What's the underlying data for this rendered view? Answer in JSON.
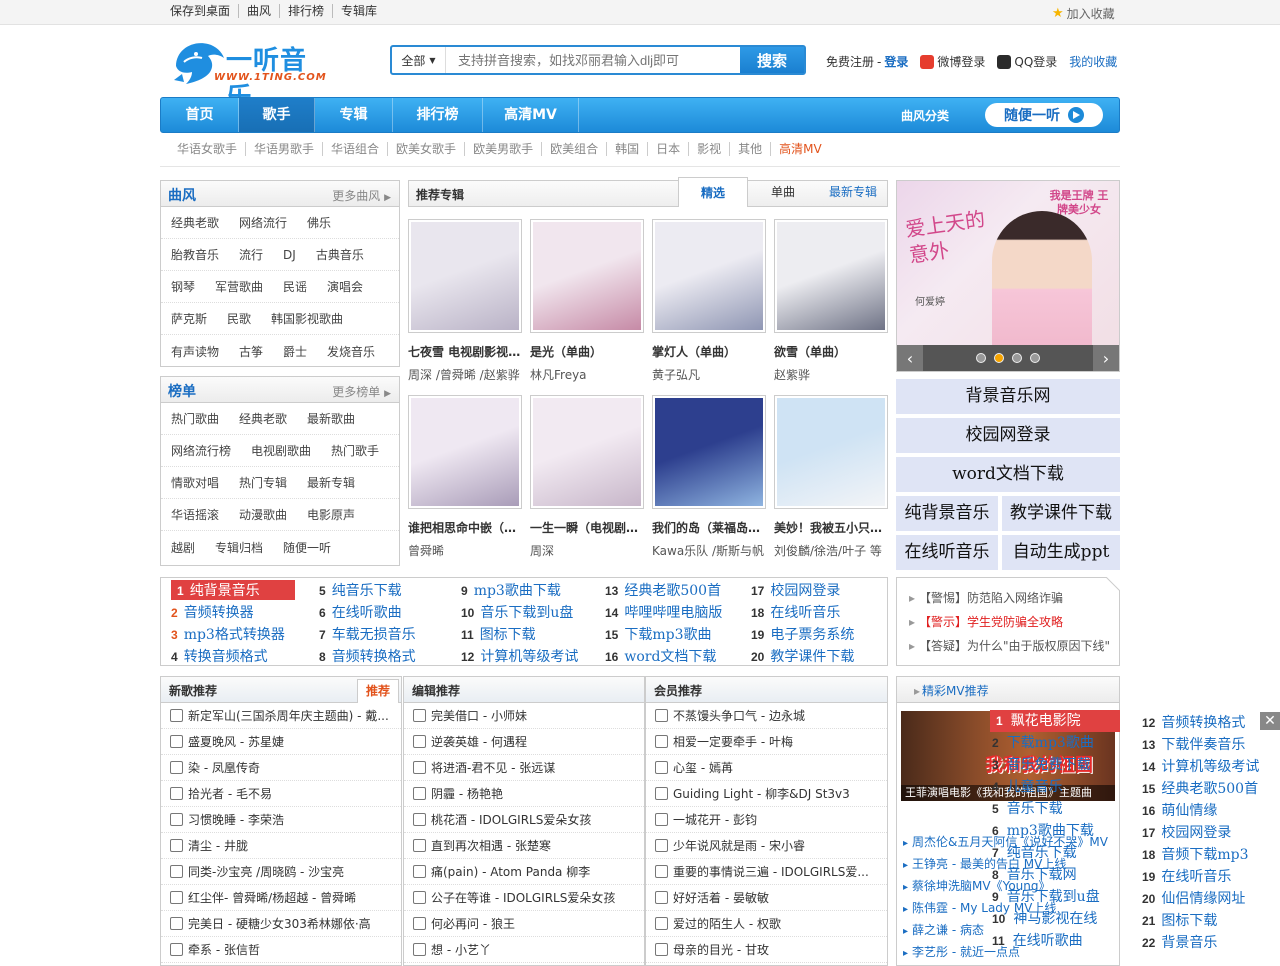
{
  "topbar": {
    "links": [
      "保存到桌面",
      "曲风",
      "排行榜",
      "专辑库"
    ],
    "favorite": "加入收藏"
  },
  "logo": {
    "text": "一听音乐",
    "sub": "WWW.1TING.COM"
  },
  "search": {
    "scope": "全部",
    "placeholder": "支持拼音搜索，如找邓丽君输入dlj即可",
    "button": "搜索"
  },
  "user": {
    "register": "免费注册",
    "sep": "-",
    "login": "登录",
    "weibo": "微博登录",
    "qq": "QQ登录",
    "mine": "我的收藏"
  },
  "nav": {
    "items": [
      "首页",
      "歌手",
      "专辑",
      "排行榜",
      "高清MV"
    ],
    "genre": "曲风分类",
    "random": "随便一听"
  },
  "subnav": [
    "华语女歌手",
    "华语男歌手",
    "华语组合",
    "欧美女歌手",
    "欧美男歌手",
    "欧美组合",
    "韩国",
    "日本",
    "影视",
    "其他",
    "高清MV"
  ],
  "genres": {
    "title": "曲风",
    "more": "更多曲风",
    "rows": [
      [
        "经典老歌",
        "网络流行",
        "佛乐"
      ],
      [
        "胎教音乐",
        "流行",
        "DJ",
        "古典音乐"
      ],
      [
        "钢琴",
        "军营歌曲",
        "民谣",
        "演唱会"
      ],
      [
        "萨克斯",
        "民歌",
        "韩国影视歌曲"
      ],
      [
        "有声读物",
        "古筝",
        "爵士",
        "发烧音乐"
      ]
    ]
  },
  "charts": {
    "title": "榜单",
    "more": "更多榜单",
    "rows": [
      [
        "热门歌曲",
        "经典老歌",
        "最新歌曲"
      ],
      [
        "网络流行榜",
        "电视剧歌曲",
        "热门歌手"
      ],
      [
        "情歌对唱",
        "热门专辑",
        "最新专辑"
      ],
      [
        "华语摇滚",
        "动漫歌曲",
        "电影原声"
      ],
      [
        "越剧",
        "专辑归档",
        "随便一听"
      ]
    ]
  },
  "albums": {
    "title": "推荐专辑",
    "tabs": [
      "精选",
      "单曲",
      "最新专辑"
    ],
    "items": [
      {
        "name": "七夜雪 电视剧影视原声带",
        "artist": "周深 /曾舜晞 /赵紫骅",
        "c1": "#e9e6ee",
        "c2": "#b9b2c6"
      },
      {
        "name": "是光（单曲）",
        "artist": "林凡Freya",
        "c1": "#f1e6ee",
        "c2": "#c68aa6"
      },
      {
        "name": "掌灯人（单曲）",
        "artist": "黄子弘凡",
        "c1": "#ecebf2",
        "c2": "#8f96b3"
      },
      {
        "name": "欲雪（单曲）",
        "artist": "赵紫骅",
        "c1": "#ededf1",
        "c2": "#6f7386"
      },
      {
        "name": "谁把相思命中嵌（单曲）",
        "artist": "曾舜晞",
        "c1": "#efe8f2",
        "c2": "#a99cb8"
      },
      {
        "name": "一生一瞬（电视剧《七夜雪》插曲）",
        "artist": "周深",
        "c1": "#f2eaf2",
        "c2": "#c7b6c9"
      },
      {
        "name": "我们的岛（莱福岛电影主题曲）",
        "artist": "Kawa乐队 /斯斯与帆",
        "c1": "#2d3f8e",
        "c2": "#8fb4e0"
      },
      {
        "name": "美妙！我被五小只包围了",
        "artist": "刘俊麟/徐浩/叶子 等",
        "c1": "#cfe3f4",
        "c2": "#f2f4f7"
      }
    ]
  },
  "banner": {
    "caption1": "爱上天的意外",
    "caption2": "何爱婷",
    "tag": "我是王牌 王牌美少女"
  },
  "right_links": [
    [
      "背景音乐网"
    ],
    [
      "校园网登录"
    ],
    [
      "word文档下载"
    ],
    [
      "纯背景音乐",
      "教学课件下载"
    ],
    [
      "在线听音乐",
      "自动生成ppt"
    ]
  ],
  "rank": [
    {
      "n": "1",
      "t": "纯背景音乐"
    },
    {
      "n": "2",
      "t": "音频转换器"
    },
    {
      "n": "3",
      "t": "mp3格式转换器"
    },
    {
      "n": "4",
      "t": "转换音频格式"
    },
    {
      "n": "5",
      "t": "纯音乐下载"
    },
    {
      "n": "6",
      "t": "在线听歌曲"
    },
    {
      "n": "7",
      "t": "车载无损音乐"
    },
    {
      "n": "8",
      "t": "音频转换格式"
    },
    {
      "n": "9",
      "t": "mp3歌曲下载"
    },
    {
      "n": "10",
      "t": "音乐下载到u盘"
    },
    {
      "n": "11",
      "t": "图标下载"
    },
    {
      "n": "12",
      "t": "计算机等级考试"
    },
    {
      "n": "13",
      "t": "经典老歌500首"
    },
    {
      "n": "14",
      "t": "哔哩哔哩电脑版"
    },
    {
      "n": "15",
      "t": "下载mp3歌曲"
    },
    {
      "n": "16",
      "t": "word文档下载"
    },
    {
      "n": "17",
      "t": "校园网登录"
    },
    {
      "n": "18",
      "t": "在线听音乐"
    },
    {
      "n": "19",
      "t": "电子票务系统"
    },
    {
      "n": "20",
      "t": "教学课件下载"
    }
  ],
  "notices": [
    {
      "t": "【警惕】防范陷入网络诈骗"
    },
    {
      "t": "【警示】学生党防骗全攻略"
    },
    {
      "t": "【答疑】为什么\"由于版权原因下线\""
    }
  ],
  "new_songs": {
    "title": "新歌推荐",
    "tab": "推荐",
    "items": [
      "新定军山(三国杀周年庆主题曲) - 戴...",
      "盛夏晚风 - 苏星婕",
      "染 - 凤凰传奇",
      "拾光者 - 毛不易",
      "习惯晚睡 - 李荣浩",
      "清尘 - 井胧",
      "同类-沙宝亮 /周晓鸥 - 沙宝亮",
      "红尘伴- 曾舜晞/杨超越 - 曾舜晞",
      "完美日 - 硬糖少女303希林娜依·高",
      "牵系 - 张信哲"
    ]
  },
  "editor_songs": {
    "title": "编辑推荐",
    "items": [
      "完美借口 - 小师妹",
      "逆袭英雄 - 何遇程",
      "将进酒-君不见 - 张远谋",
      "阴霾 - 杨艳艳",
      "桃花酒 - IDOLGIRLS爱朵女孩",
      "直到再次相遇 - 张楚寒",
      "痛(pain) - Atom Panda 柳李",
      "公子在等谁 - IDOLGIRLS爱朵女孩",
      "何必再问 - 狼王",
      "想 - 小艺丫"
    ]
  },
  "member_songs": {
    "title": "会员推荐",
    "items": [
      "不蒸馒头争口气 - 边永城",
      "相爱一定要牵手 - 叶梅",
      "心玺 - 嫣苒",
      "Guiding Light - 柳李&DJ St3v3",
      "一城花开 - 彭钧",
      "少年说风就是雨 - 宋小睿",
      "重要的事情说三遍 - IDOLGIRLS爱...",
      "好好活着 - 晏敏敏",
      "爱过的陌生人 - 权歌",
      "母亲的目光 - 甘玫"
    ]
  },
  "mv": {
    "title": "精彩MV推荐",
    "caption": "王菲演唱电影《我和我的祖国》主题曲",
    "image_text": "我和我的祖国",
    "items": [
      "周杰伦&五月天阿信《说好不哭》MV",
      "王铮亮 - 最美的告白 MV上线",
      "蔡徐坤洗脑MV《Young》",
      "陈伟霆 - My Lady MV上线",
      "薛之谦 - 病态",
      "李艺彤 - 就近一点点"
    ]
  },
  "float1": {
    "head": {
      "n": "1",
      "t": "飘花电影院"
    },
    "items": [
      {
        "n": "2",
        "t": "下载mp3歌曲"
      },
      {
        "n": "3",
        "t": "音乐免费下载"
      },
      {
        "n": "4",
        "t": "儿童音乐"
      },
      {
        "n": "5",
        "t": "音乐下载"
      },
      {
        "n": "6",
        "t": "mp3歌曲下载"
      },
      {
        "n": "7",
        "t": "纯音乐下载"
      },
      {
        "n": "8",
        "t": "音乐下载网"
      },
      {
        "n": "9",
        "t": "音乐下载到u盘"
      },
      {
        "n": "10",
        "t": "神马影视在线"
      },
      {
        "n": "11",
        "t": "在线听歌曲"
      }
    ]
  },
  "float2": {
    "close": "✕",
    "items": [
      {
        "n": "12",
        "t": "音频转换格式"
      },
      {
        "n": "13",
        "t": "下载伴奏音乐"
      },
      {
        "n": "14",
        "t": "计算机等级考试"
      },
      {
        "n": "15",
        "t": "经典老歌500首"
      },
      {
        "n": "16",
        "t": "萌仙情缘"
      },
      {
        "n": "17",
        "t": "校园网登录"
      },
      {
        "n": "18",
        "t": "音频下载mp3"
      },
      {
        "n": "19",
        "t": "在线听音乐"
      },
      {
        "n": "20",
        "t": "仙侣情缘网址"
      },
      {
        "n": "21",
        "t": "图标下载"
      },
      {
        "n": "22",
        "t": "背景音乐"
      }
    ]
  },
  "colors": {
    "primary": "#1a6dc2",
    "nav": "#1d8ad8",
    "accent": "#e2531c",
    "highlight": "#e04141"
  }
}
